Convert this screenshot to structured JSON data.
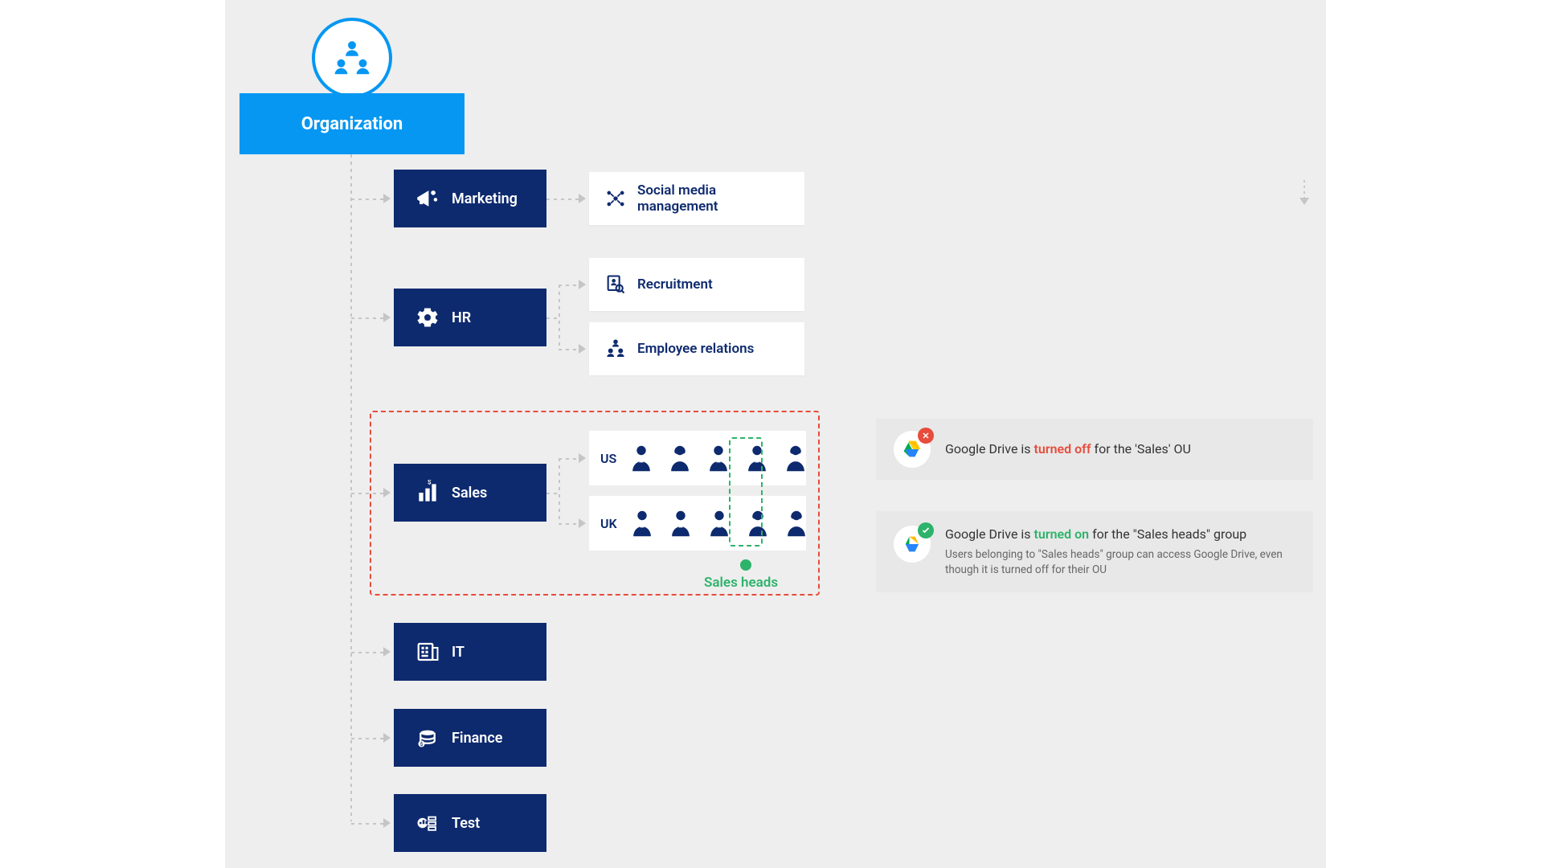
{
  "org": {
    "label": "Organization"
  },
  "departments": {
    "marketing": {
      "label": "Marketing"
    },
    "hr": {
      "label": "HR"
    },
    "sales": {
      "label": "Sales"
    },
    "it": {
      "label": "IT"
    },
    "finance": {
      "label": "Finance"
    },
    "test": {
      "label": "Test"
    }
  },
  "subunits": {
    "marketing_social": {
      "label": "Social media management"
    },
    "hr_recruitment": {
      "label": "Recruitment"
    },
    "hr_employee_relations": {
      "label": "Employee relations"
    }
  },
  "sales": {
    "regions": {
      "us": "US",
      "uk": "UK"
    },
    "heads_label": "Sales heads"
  },
  "notices": {
    "off": {
      "prefix": "Google Drive is ",
      "status": "turned off",
      "suffix": " for the 'Sales' OU"
    },
    "on": {
      "prefix": "Google Drive is ",
      "status": "turned on",
      "suffix": " for the \"Sales heads\" group",
      "detail": "Users belonging to \"Sales heads\" group can access Google Drive, even though it is turned off for their OU"
    }
  }
}
